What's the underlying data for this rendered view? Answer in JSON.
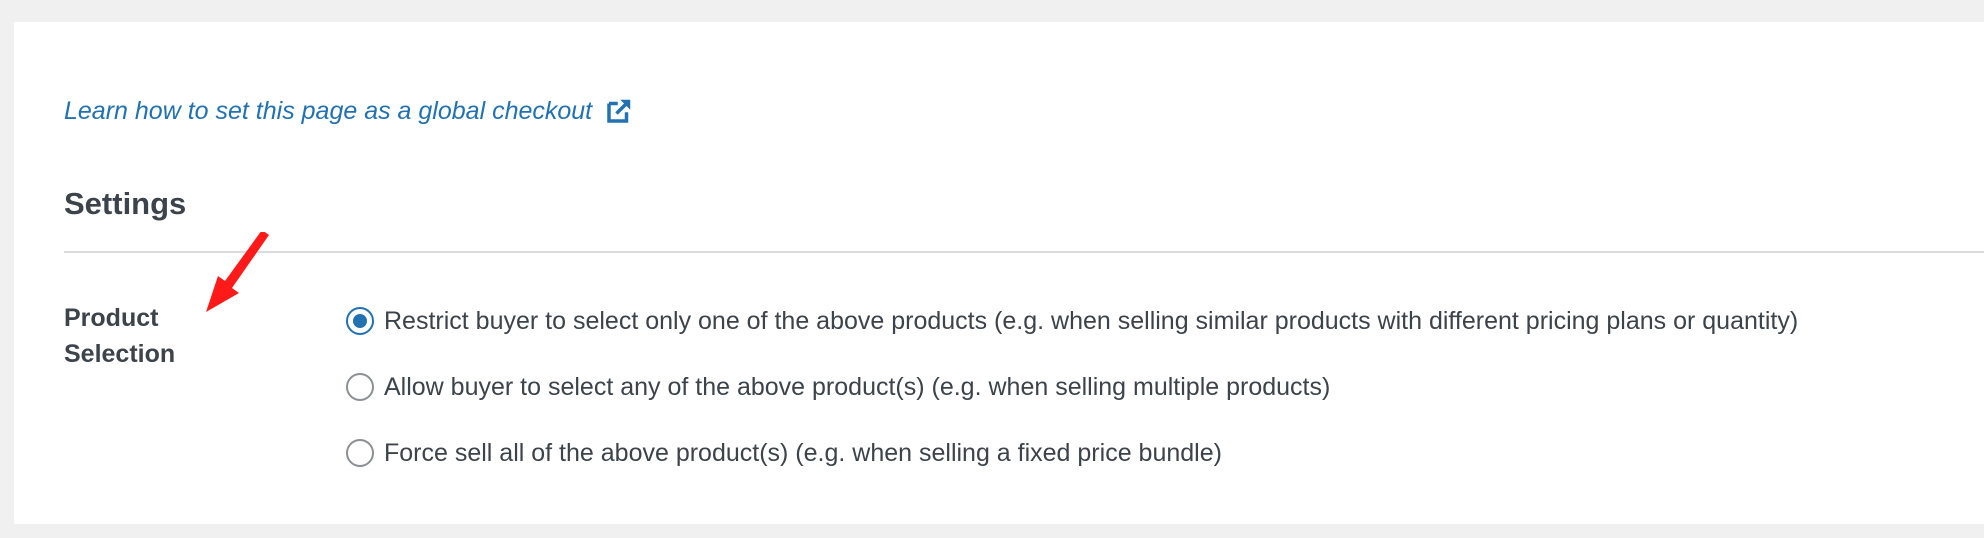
{
  "guide_link": {
    "text": "Learn how to set this page as a global checkout",
    "icon": "external-link-icon"
  },
  "settings": {
    "title": "Settings",
    "product_selection": {
      "label_line1": "Product",
      "label_line2": "Selection",
      "options": [
        {
          "label": "Restrict buyer to select only one of the above products (e.g. when selling similar products with different pricing plans or quantity)",
          "selected": true
        },
        {
          "label": "Allow buyer to select any of the above product(s) (e.g. when selling multiple products)",
          "selected": false
        },
        {
          "label": "Force sell all of the above product(s) (e.g. when selling a fixed price bundle)",
          "selected": false
        }
      ]
    }
  },
  "colors": {
    "accent": "#2271b1",
    "annotation": "#ff1a1a",
    "text": "#3c434a",
    "background": "#f0f0f1"
  }
}
